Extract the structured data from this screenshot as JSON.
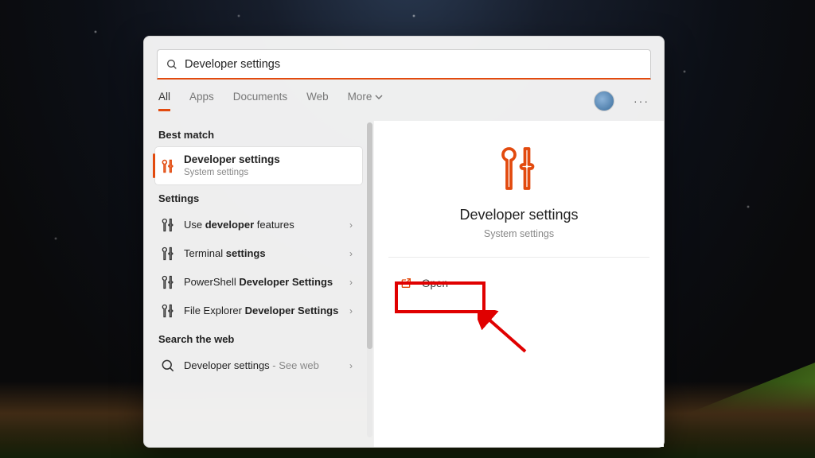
{
  "search": {
    "query": "Developer settings"
  },
  "tabs": {
    "items": [
      {
        "label": "All",
        "active": true
      },
      {
        "label": "Apps"
      },
      {
        "label": "Documents"
      },
      {
        "label": "Web"
      }
    ],
    "more_label": "More"
  },
  "sections": {
    "best_match_label": "Best match",
    "settings_label": "Settings",
    "search_web_label": "Search the web"
  },
  "best_match": {
    "title": "Developer settings",
    "subtitle": "System settings"
  },
  "settings_results": [
    {
      "prefix": "Use ",
      "bold": "developer",
      "suffix": " features"
    },
    {
      "prefix": "Terminal ",
      "bold": "settings",
      "suffix": ""
    },
    {
      "prefix": "PowerShell ",
      "bold": "Developer Settings",
      "suffix": ""
    },
    {
      "prefix": "File Explorer ",
      "bold": "Developer Settings",
      "suffix": ""
    }
  ],
  "web_result": {
    "title": "Developer settings",
    "suffix": " - See web"
  },
  "preview": {
    "title": "Developer settings",
    "subtitle": "System settings",
    "open_label": "Open"
  },
  "colors": {
    "accent": "#e24a0e",
    "annotation": "#e00000"
  }
}
